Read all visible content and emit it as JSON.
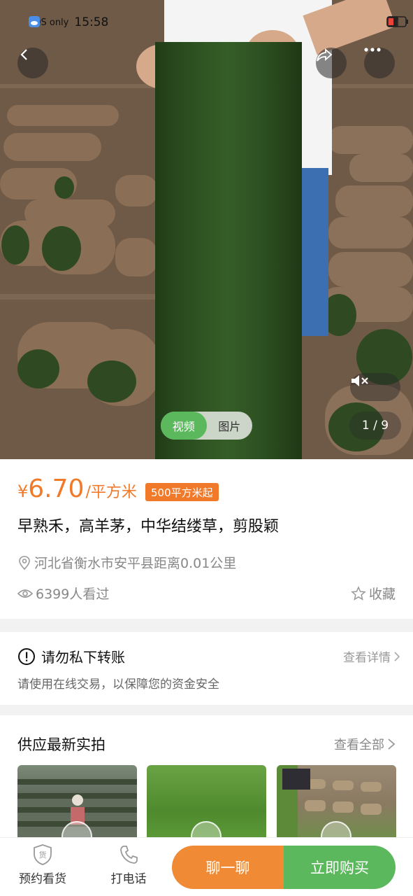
{
  "status_bar": {
    "sos": "SOS only",
    "time": "15:58"
  },
  "media": {
    "tabs": [
      {
        "label": "视频",
        "active": true
      },
      {
        "label": "图片",
        "active": false
      }
    ],
    "counter": "1 / 9"
  },
  "product": {
    "currency": "¥",
    "price": "6.70",
    "unit": "/平方米",
    "min_order": "500平方米起",
    "title": "早熟禾，高羊茅，中华结缕草，剪股颖",
    "location": "河北省衡水市安平县距离0.01公里",
    "views": "6399人看过",
    "favorite_label": "收藏"
  },
  "notice": {
    "title": "请勿私下转账",
    "detail_link": "查看详情",
    "subtitle": "请使用在线交易，以保障您的资金安全"
  },
  "gallery": {
    "title": "供应最新实拍",
    "view_all": "查看全部"
  },
  "bottom_bar": {
    "reserve_label": "预约看货",
    "call_label": "打电话",
    "chat_button": "聊一聊",
    "buy_button": "立即购买"
  },
  "colors": {
    "price_orange": "#f07a2a",
    "chat_orange": "#f08a35",
    "buy_green": "#5cb85c"
  }
}
